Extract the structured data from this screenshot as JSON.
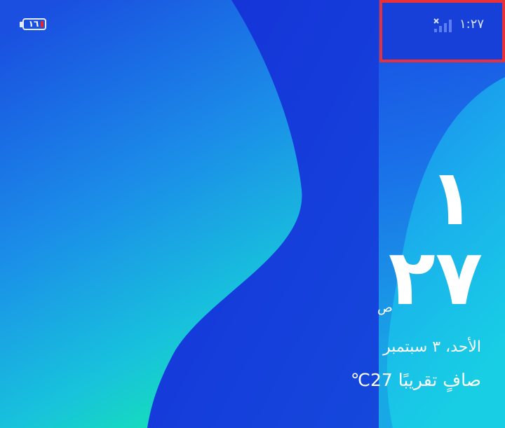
{
  "status_bar": {
    "time": "١:٢٧",
    "battery_level": "١٦",
    "signal_icon": "signal-off-icon",
    "battery_icon": "battery-low-icon",
    "highlight_color": "#e8303a"
  },
  "lockscreen": {
    "hour": "١",
    "minute": "٢٧",
    "ampm": "ص",
    "date": "الأحد، ٣ سبتمبر",
    "weather": "صافٍ تقريبًا ‎27℃"
  },
  "colors": {
    "wallpaper_blue": "#1846e0",
    "wallpaper_cyan": "#14d0c8",
    "battery_low": "#e8232a"
  }
}
